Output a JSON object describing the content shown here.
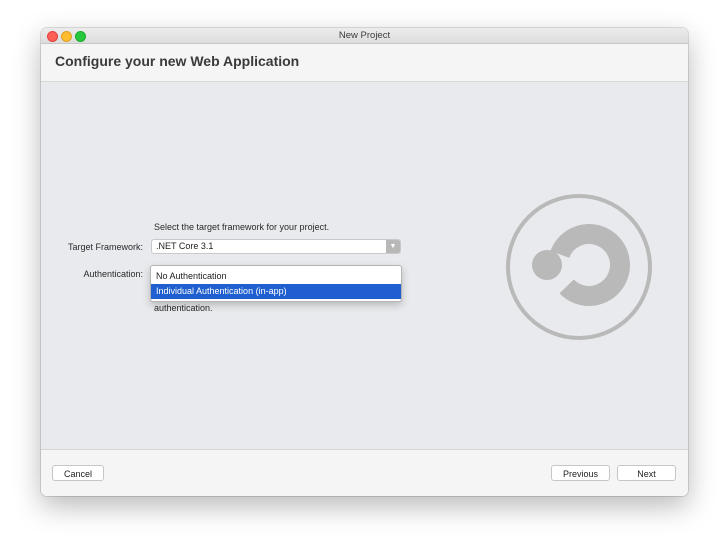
{
  "window": {
    "title": "New Project"
  },
  "header": {
    "title": "Configure your new Web Application"
  },
  "form": {
    "hint": "Select the target framework for your project.",
    "framework_label": "Target Framework:",
    "framework_value": ".NET Core 3.1",
    "auth_label": "Authentication:",
    "auth_description": "authentication.",
    "auth_options": [
      {
        "label": "No Authentication",
        "selected": false
      },
      {
        "label": "Individual Authentication (in-app)",
        "selected": true
      }
    ]
  },
  "footer": {
    "cancel_label": "Cancel",
    "previous_label": "Previous",
    "next_label": "Next"
  },
  "colors": {
    "selection": "#1f5fcf",
    "logo": "#b9b9b9",
    "content_background": "#e8eaed"
  },
  "icons": {
    "logo": "dotnet-core-logo-icon",
    "dropdown_arrow": "chevron-down-icon"
  }
}
